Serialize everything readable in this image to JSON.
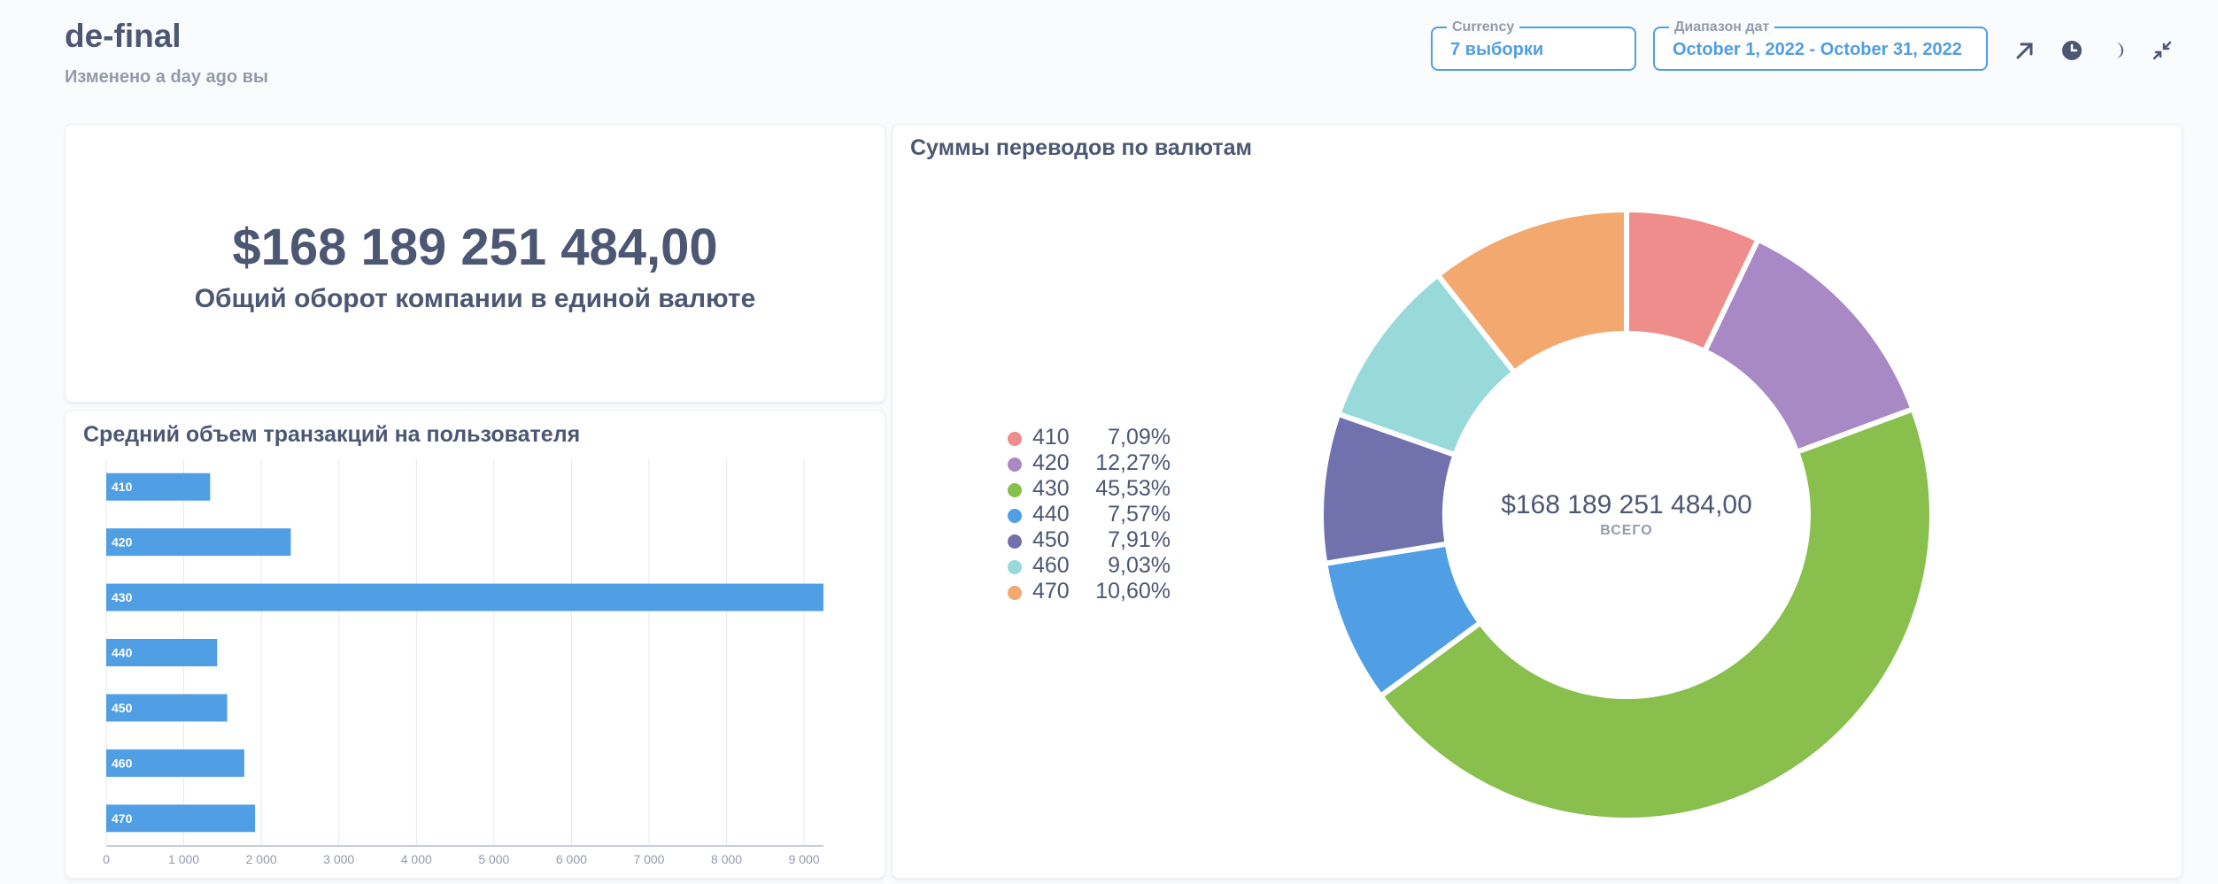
{
  "header": {
    "title": "de-final",
    "subtitle": "Изменено a day ago вы"
  },
  "filters": {
    "currency": {
      "label": "Currency",
      "value": "7 выборки"
    },
    "dates": {
      "label": "Диапазон дат",
      "value": "October 1, 2022 - October 31, 2022"
    }
  },
  "header_icons": [
    "arrow-up-right-icon",
    "clock-icon",
    "moon-icon",
    "collapse-icon"
  ],
  "total_card": {
    "value": "$168 189 251 484,00",
    "label": "Общий оборот компании в единой валюте"
  },
  "avg_card": {
    "title": "Средний объем транзакций на пользователя"
  },
  "donut_card": {
    "title": "Суммы переводов по валютам",
    "total_value": "$168 189 251 484,00",
    "total_label": "ВСЕГО"
  },
  "colors": {
    "accent": "#509ee3",
    "text": "#4c5773",
    "muted": "#949aab"
  },
  "chart_data": [
    {
      "type": "bar",
      "orientation": "horizontal",
      "title": "Средний объем транзакций на пользователя",
      "categories": [
        "410",
        "420",
        "430",
        "440",
        "450",
        "460",
        "470"
      ],
      "values": [
        1340,
        2380,
        9250,
        1430,
        1560,
        1780,
        1920
      ],
      "xlim": [
        0,
        9250
      ],
      "x_ticks": [
        0,
        1000,
        2000,
        3000,
        4000,
        5000,
        6000,
        7000,
        8000,
        9000
      ],
      "x_tick_labels": [
        "0",
        "1 000",
        "2 000",
        "3 000",
        "4 000",
        "5 000",
        "6 000",
        "7 000",
        "8 000",
        "9 000"
      ],
      "bar_color": "#509ee3",
      "grid": true
    },
    {
      "type": "pie",
      "title": "Суммы переводов по валютам",
      "labels": [
        "410",
        "420",
        "430",
        "440",
        "450",
        "460",
        "470"
      ],
      "values": [
        7.09,
        12.27,
        45.53,
        7.57,
        7.91,
        9.03,
        10.6
      ],
      "percent_labels": [
        "7,09%",
        "12,27%",
        "45,53%",
        "7,57%",
        "7,91%",
        "9,03%",
        "10,60%"
      ],
      "colors": [
        "#ef8c8c",
        "#a989c5",
        "#88bf4d",
        "#509ee3",
        "#7172ad",
        "#98d9d9",
        "#f2a86f"
      ],
      "legend_position": "left"
    }
  ]
}
